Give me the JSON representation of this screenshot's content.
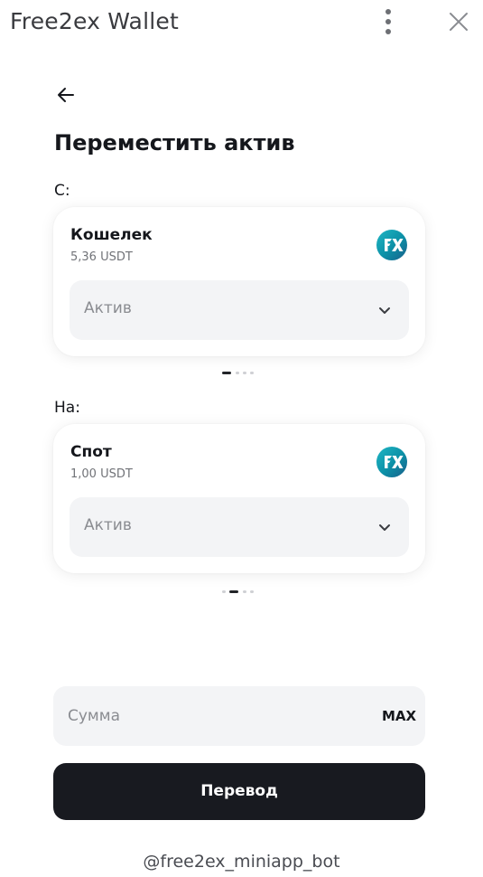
{
  "app": {
    "title": "Free2ex Wallet"
  },
  "page": {
    "title": "Переместить актив"
  },
  "from": {
    "label": "С:",
    "account_name": "Кошелек",
    "balance": "5,36 USDT",
    "asset_placeholder": "Актив",
    "pager": {
      "count": 4,
      "active": 0
    }
  },
  "to": {
    "label": "На:",
    "account_name": "Спот",
    "balance": "1,00 USDT",
    "asset_placeholder": "Актив",
    "pager": {
      "count": 4,
      "active": 1
    }
  },
  "amount": {
    "placeholder": "Сумма",
    "max_label": "MAX"
  },
  "submit": {
    "label": "Перевод"
  },
  "footer": {
    "bot_handle": "@free2ex_miniapp_bot"
  },
  "icons": {
    "menu": "more-vertical-icon",
    "close": "close-icon",
    "back": "arrow-left-icon",
    "brand": "free2ex-logo-icon",
    "chevron": "chevron-down-icon"
  },
  "colors": {
    "primary_button": "#181a20",
    "field_bg": "#f3f4f6",
    "brand_teal": "#1fb7c4"
  }
}
